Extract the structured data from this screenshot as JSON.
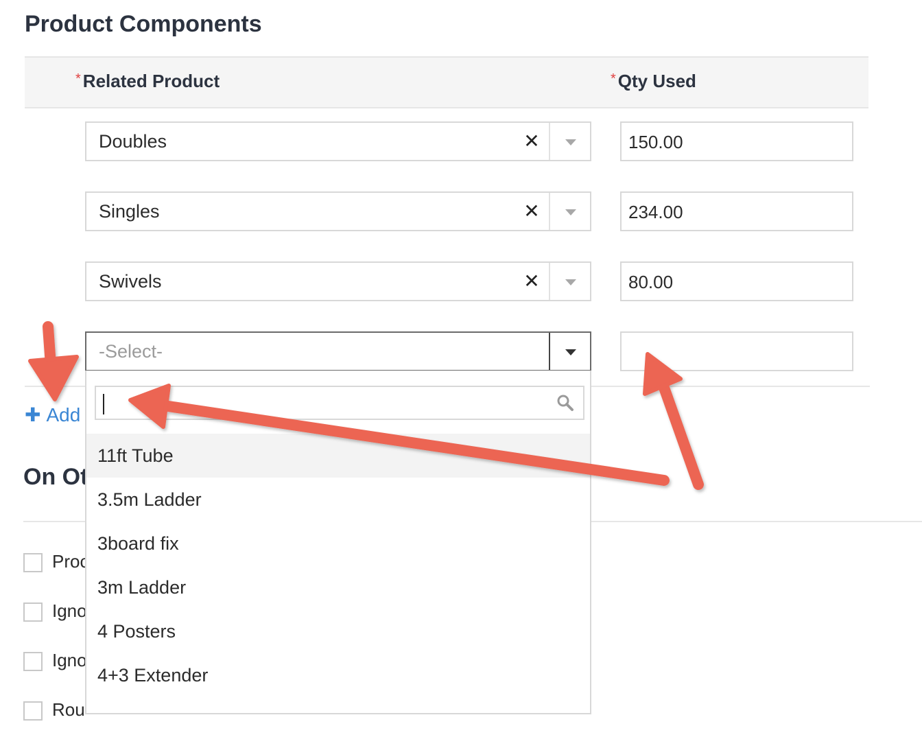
{
  "page": {
    "title": "Product Components",
    "section2_title": "On Ot"
  },
  "table": {
    "columns": [
      {
        "required_mark": "*",
        "label": "Related Product"
      },
      {
        "required_mark": "*",
        "label": "Qty Used"
      }
    ],
    "rows": [
      {
        "product": "Doubles",
        "clear": "✕",
        "qty": "150.00"
      },
      {
        "product": "Singles",
        "clear": "✕",
        "qty": "234.00"
      },
      {
        "product": "Swivels",
        "clear": "✕",
        "qty": "80.00"
      }
    ],
    "new_row": {
      "placeholder": "-Select-",
      "qty": ""
    }
  },
  "add_link": {
    "icon": "plus-icon",
    "label": "Add"
  },
  "dropdown": {
    "search_value": "",
    "search_icon": "search-icon",
    "options": [
      "11ft Tube",
      "3.5m Ladder",
      "3board fix",
      "3m Ladder",
      "4 Posters",
      "4+3 Extender"
    ],
    "highlighted_index": 0
  },
  "checkboxes": [
    {
      "label": "Proc",
      "checked": false
    },
    {
      "label": "Igno",
      "checked": false
    },
    {
      "label": "Igno",
      "checked": false
    },
    {
      "label": "Rou",
      "checked": false
    }
  ],
  "colors": {
    "annotation_arrow": "#ec6553",
    "link": "#3a86d4",
    "required": "#e04040"
  }
}
